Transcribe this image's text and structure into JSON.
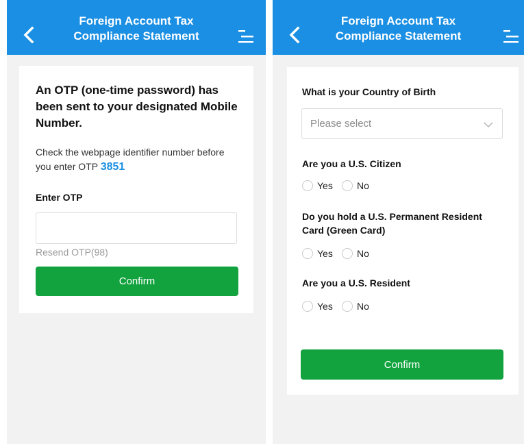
{
  "left_screen": {
    "header": {
      "title_line1": "Foreign Account Tax",
      "title_line2": "Compliance Statement",
      "back_icon": "chevron-left-icon",
      "menu_icon": "menu-icon"
    },
    "otp": {
      "heading": "An OTP (one-time password) has been sent to your designated Mobile Number.",
      "note_prefix": "Check the webpage identifier number before you enter OTP",
      "identifier": "3851",
      "input_label": "Enter OTP",
      "input_value": "",
      "resend": "Resend OTP(98)",
      "confirm": "Confirm"
    }
  },
  "right_screen": {
    "header": {
      "title_line1": "Foreign Account Tax",
      "title_line2": "Compliance Statement",
      "back_icon": "chevron-left-icon",
      "menu_icon": "menu-icon"
    },
    "form": {
      "country_label": "What is your Country of Birth",
      "country_placeholder": "Please select",
      "citizen_label": "Are you a U.S. Citizen",
      "green_card_label": "Do you hold a U.S. Permanent Resident Card (Green Card)",
      "resident_label": "Are you a U.S. Resident",
      "yes": "Yes",
      "no": "No",
      "confirm": "Confirm"
    }
  },
  "colors": {
    "header_blue": "#1a8fe3",
    "confirm_green": "#12a33f",
    "identifier_blue": "#1a8fe3"
  }
}
